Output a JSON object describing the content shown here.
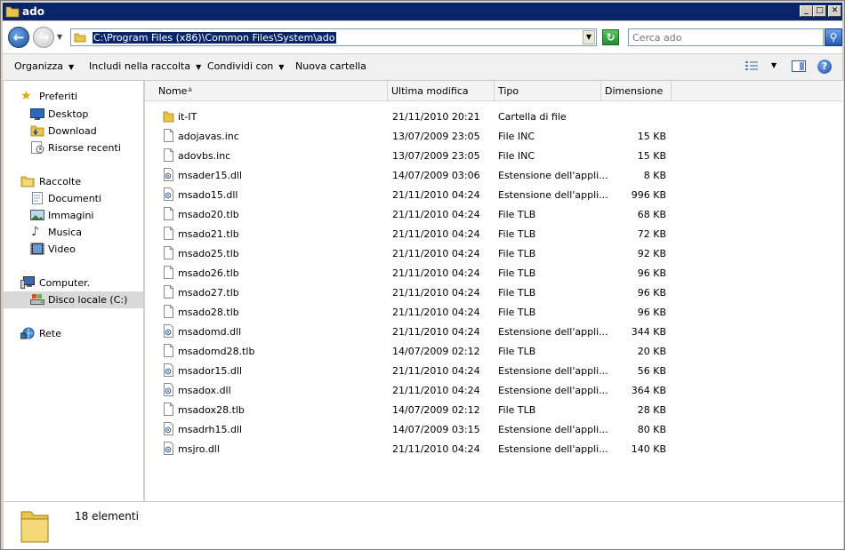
{
  "window": {
    "title": "ado"
  },
  "address": {
    "path": "C:\\Program Files (x86)\\Common Files\\System\\ado"
  },
  "search": {
    "placeholder": "Cerca ado"
  },
  "toolbar": {
    "organize": "Organizza",
    "include": "Includi nella raccolta",
    "share": "Condividi con",
    "new_folder": "Nuova cartella"
  },
  "nav": {
    "favorites": "Preferiti",
    "desktop": "Desktop",
    "download": "Download",
    "recent": "Risorse recenti",
    "libraries": "Raccolte",
    "documents": "Documenti",
    "images": "Immagini",
    "music": "Musica",
    "video": "Video",
    "computer": "Computer.",
    "local_disk": "Disco locale (C:)",
    "network": "Rete"
  },
  "columns": {
    "name": "Nome",
    "modified": "Ultima modifica",
    "type": "Tipo",
    "size": "Dimensione"
  },
  "files": [
    {
      "name": "it-IT",
      "date": "21/11/2010 20:21",
      "type": "Cartella di file",
      "size": "",
      "icon": "folder-icon"
    },
    {
      "name": "adojavas.inc",
      "date": "13/07/2009 23:05",
      "type": "File INC",
      "size": "15 KB",
      "icon": "file-icon"
    },
    {
      "name": "adovbs.inc",
      "date": "13/07/2009 23:05",
      "type": "File INC",
      "size": "15 KB",
      "icon": "file-icon"
    },
    {
      "name": "msader15.dll",
      "date": "14/07/2009 03:06",
      "type": "Estensione dell'appli...",
      "size": "8 KB",
      "icon": "dll-icon"
    },
    {
      "name": "msado15.dll",
      "date": "21/11/2010 04:24",
      "type": "Estensione dell'appli...",
      "size": "996 KB",
      "icon": "dll-icon"
    },
    {
      "name": "msado20.tlb",
      "date": "21/11/2010 04:24",
      "type": "File TLB",
      "size": "68 KB",
      "icon": "file-icon"
    },
    {
      "name": "msado21.tlb",
      "date": "21/11/2010 04:24",
      "type": "File TLB",
      "size": "72 KB",
      "icon": "file-icon"
    },
    {
      "name": "msado25.tlb",
      "date": "21/11/2010 04:24",
      "type": "File TLB",
      "size": "92 KB",
      "icon": "file-icon"
    },
    {
      "name": "msado26.tlb",
      "date": "21/11/2010 04:24",
      "type": "File TLB",
      "size": "96 KB",
      "icon": "file-icon"
    },
    {
      "name": "msado27.tlb",
      "date": "21/11/2010 04:24",
      "type": "File TLB",
      "size": "96 KB",
      "icon": "file-icon"
    },
    {
      "name": "msado28.tlb",
      "date": "21/11/2010 04:24",
      "type": "File TLB",
      "size": "96 KB",
      "icon": "file-icon"
    },
    {
      "name": "msadomd.dll",
      "date": "21/11/2010 04:24",
      "type": "Estensione dell'appli...",
      "size": "344 KB",
      "icon": "dll-icon"
    },
    {
      "name": "msadomd28.tlb",
      "date": "14/07/2009 02:12",
      "type": "File TLB",
      "size": "20 KB",
      "icon": "file-icon"
    },
    {
      "name": "msador15.dll",
      "date": "21/11/2010 04:24",
      "type": "Estensione dell'appli...",
      "size": "56 KB",
      "icon": "dll-icon"
    },
    {
      "name": "msadox.dll",
      "date": "21/11/2010 04:24",
      "type": "Estensione dell'appli...",
      "size": "364 KB",
      "icon": "dll-icon"
    },
    {
      "name": "msadox28.tlb",
      "date": "14/07/2009 02:12",
      "type": "File TLB",
      "size": "28 KB",
      "icon": "file-icon"
    },
    {
      "name": "msadrh15.dll",
      "date": "14/07/2009 03:15",
      "type": "Estensione dell'appli...",
      "size": "80 KB",
      "icon": "dll-icon"
    },
    {
      "name": "msjro.dll",
      "date": "21/11/2010 04:24",
      "type": "Estensione dell'appli...",
      "size": "140 KB",
      "icon": "dll-icon"
    }
  ],
  "status": {
    "count": "18 elementi"
  },
  "colors": {
    "title_bar": "#0a246a",
    "selection": "#0a246a",
    "folder": "#e8c44a"
  }
}
